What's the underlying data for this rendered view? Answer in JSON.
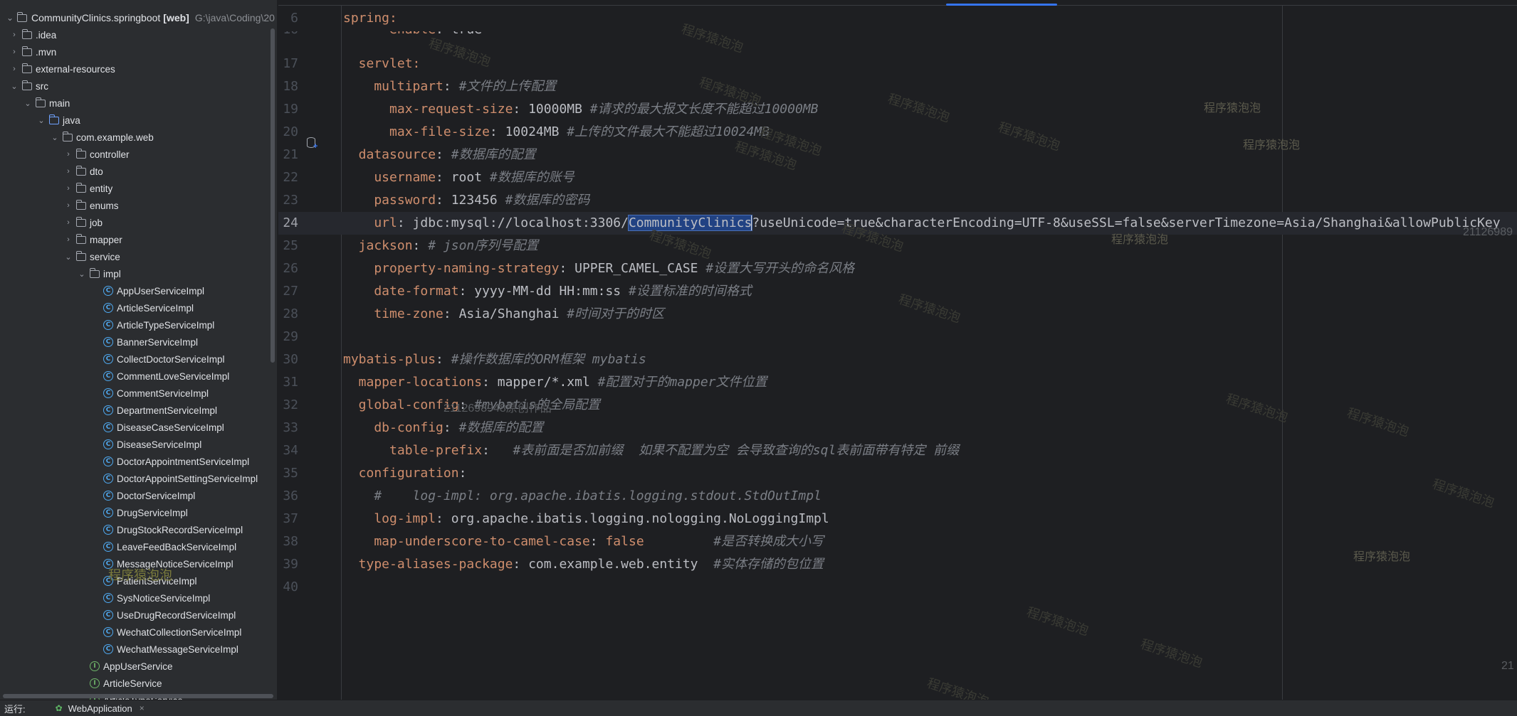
{
  "project_tree": {
    "root": {
      "name": "CommunityClinics.springboot",
      "flag": "[web]",
      "path": "G:\\java\\Coding\\20"
    },
    "items": [
      {
        "label": ".idea",
        "type": "folder",
        "depth": 1,
        "arrow": "›"
      },
      {
        "label": ".mvn",
        "type": "folder",
        "depth": 1,
        "arrow": "›"
      },
      {
        "label": "external-resources",
        "type": "folder",
        "depth": 1,
        "arrow": "›"
      },
      {
        "label": "src",
        "type": "folder",
        "depth": 1,
        "arrow": "⌄"
      },
      {
        "label": "main",
        "type": "folder",
        "depth": 2,
        "arrow": "⌄"
      },
      {
        "label": "java",
        "type": "src-folder",
        "depth": 3,
        "arrow": "⌄"
      },
      {
        "label": "com.example.web",
        "type": "folder",
        "depth": 4,
        "arrow": "⌄"
      },
      {
        "label": "controller",
        "type": "folder",
        "depth": 5,
        "arrow": "›"
      },
      {
        "label": "dto",
        "type": "folder",
        "depth": 5,
        "arrow": "›"
      },
      {
        "label": "entity",
        "type": "folder",
        "depth": 5,
        "arrow": "›"
      },
      {
        "label": "enums",
        "type": "folder",
        "depth": 5,
        "arrow": "›"
      },
      {
        "label": "job",
        "type": "folder",
        "depth": 5,
        "arrow": "›"
      },
      {
        "label": "mapper",
        "type": "folder",
        "depth": 5,
        "arrow": "›"
      },
      {
        "label": "service",
        "type": "folder",
        "depth": 5,
        "arrow": "⌄"
      },
      {
        "label": "impl",
        "type": "folder",
        "depth": 6,
        "arrow": "⌄"
      },
      {
        "label": "AppUserServiceImpl",
        "type": "class",
        "depth": 7,
        "arrow": ""
      },
      {
        "label": "ArticleServiceImpl",
        "type": "class",
        "depth": 7,
        "arrow": ""
      },
      {
        "label": "ArticleTypeServiceImpl",
        "type": "class",
        "depth": 7,
        "arrow": ""
      },
      {
        "label": "BannerServiceImpl",
        "type": "class",
        "depth": 7,
        "arrow": ""
      },
      {
        "label": "CollectDoctorServiceImpl",
        "type": "class",
        "depth": 7,
        "arrow": ""
      },
      {
        "label": "CommentLoveServiceImpl",
        "type": "class",
        "depth": 7,
        "arrow": ""
      },
      {
        "label": "CommentServiceImpl",
        "type": "class",
        "depth": 7,
        "arrow": ""
      },
      {
        "label": "DepartmentServiceImpl",
        "type": "class",
        "depth": 7,
        "arrow": ""
      },
      {
        "label": "DiseaseCaseServiceImpl",
        "type": "class",
        "depth": 7,
        "arrow": ""
      },
      {
        "label": "DiseaseServiceImpl",
        "type": "class",
        "depth": 7,
        "arrow": ""
      },
      {
        "label": "DoctorAppointmentServiceImpl",
        "type": "class",
        "depth": 7,
        "arrow": ""
      },
      {
        "label": "DoctorAppointSettingServiceImpl",
        "type": "class",
        "depth": 7,
        "arrow": ""
      },
      {
        "label": "DoctorServiceImpl",
        "type": "class",
        "depth": 7,
        "arrow": ""
      },
      {
        "label": "DrugServiceImpl",
        "type": "class",
        "depth": 7,
        "arrow": ""
      },
      {
        "label": "DrugStockRecordServiceImpl",
        "type": "class",
        "depth": 7,
        "arrow": ""
      },
      {
        "label": "LeaveFeedBackServiceImpl",
        "type": "class",
        "depth": 7,
        "arrow": ""
      },
      {
        "label": "MessageNoticeServiceImpl",
        "type": "class",
        "depth": 7,
        "arrow": ""
      },
      {
        "label": "PatientServiceImpl",
        "type": "class",
        "depth": 7,
        "arrow": ""
      },
      {
        "label": "SysNoticeServiceImpl",
        "type": "class",
        "depth": 7,
        "arrow": ""
      },
      {
        "label": "UseDrugRecordServiceImpl",
        "type": "class",
        "depth": 7,
        "arrow": ""
      },
      {
        "label": "WechatCollectionServiceImpl",
        "type": "class",
        "depth": 7,
        "arrow": ""
      },
      {
        "label": "WechatMessageServiceImpl",
        "type": "class",
        "depth": 7,
        "arrow": ""
      },
      {
        "label": "AppUserService",
        "type": "interface",
        "depth": 6,
        "arrow": ""
      },
      {
        "label": "ArticleService",
        "type": "interface",
        "depth": 6,
        "arrow": ""
      },
      {
        "label": "ArticleTypeService",
        "type": "interface",
        "depth": 6,
        "arrow": ""
      }
    ]
  },
  "editor": {
    "current_line": "24",
    "lines": [
      {
        "n": "6",
        "segs": [
          [
            "k",
            "spring:"
          ]
        ]
      },
      {
        "n": "16",
        "segs": [
          [
            "k",
            "      enable"
          ],
          [
            "v",
            ": true"
          ]
        ]
      },
      {
        "n": "17",
        "segs": [
          [
            "k",
            "  servlet:"
          ]
        ]
      },
      {
        "n": "18",
        "segs": [
          [
            "k",
            "    multipart"
          ],
          [
            "v",
            ": "
          ],
          [
            "c",
            "#文件的上传配置"
          ]
        ]
      },
      {
        "n": "19",
        "segs": [
          [
            "k",
            "      max-request-size"
          ],
          [
            "v",
            ": 10000MB "
          ],
          [
            "c",
            "#请求的最大报文长度不能超过10000MB"
          ]
        ]
      },
      {
        "n": "20",
        "segs": [
          [
            "k",
            "      max-file-size"
          ],
          [
            "v",
            ": 10024MB "
          ],
          [
            "c",
            "#上传的文件最大不能超过10024MB"
          ]
        ]
      },
      {
        "n": "21",
        "segs": [
          [
            "k",
            "  datasource"
          ],
          [
            "v",
            ": "
          ],
          [
            "c",
            "#数据库的配置"
          ]
        ]
      },
      {
        "n": "22",
        "segs": [
          [
            "k",
            "    username"
          ],
          [
            "v",
            ": root "
          ],
          [
            "c",
            "#数据库的账号"
          ]
        ]
      },
      {
        "n": "23",
        "segs": [
          [
            "k",
            "    password"
          ],
          [
            "v",
            ": 123456 "
          ],
          [
            "c",
            "#数据库的密码"
          ]
        ]
      },
      {
        "n": "24",
        "segs": [
          [
            "k",
            "    url"
          ],
          [
            "v",
            ": jdbc:mysql://localhost:3306/"
          ],
          [
            "sel",
            "CommunityClinics"
          ],
          [
            "caret",
            ""
          ],
          [
            "v",
            "?useUnicode=true&characterEncoding=UTF-8&useSSL=false&serverTimezone=Asia/Shanghai&allowPublicKey"
          ]
        ]
      },
      {
        "n": "25",
        "segs": [
          [
            "k",
            "  jackson"
          ],
          [
            "v",
            ": "
          ],
          [
            "c",
            "# json序列号配置"
          ]
        ]
      },
      {
        "n": "26",
        "segs": [
          [
            "k",
            "    property-naming-strategy"
          ],
          [
            "v",
            ": UPPER_CAMEL_CASE "
          ],
          [
            "c",
            "#设置大写开头的命名风格"
          ]
        ]
      },
      {
        "n": "27",
        "segs": [
          [
            "k",
            "    date-format"
          ],
          [
            "v",
            ": yyyy-MM-dd HH:mm:ss "
          ],
          [
            "c",
            "#设置标准的时间格式"
          ]
        ]
      },
      {
        "n": "28",
        "segs": [
          [
            "k",
            "    time-zone"
          ],
          [
            "v",
            ": Asia/Shanghai "
          ],
          [
            "c",
            "#时间对于的时区"
          ]
        ]
      },
      {
        "n": "29",
        "segs": []
      },
      {
        "n": "30",
        "segs": [
          [
            "k",
            "mybatis-plus"
          ],
          [
            "v",
            ": "
          ],
          [
            "c",
            "#操作数据库的ORM框架 mybatis"
          ]
        ]
      },
      {
        "n": "31",
        "segs": [
          [
            "k",
            "  mapper-locations"
          ],
          [
            "v",
            ": mapper/*.xml "
          ],
          [
            "c",
            "#配置对于的mapper文件位置"
          ]
        ]
      },
      {
        "n": "32",
        "segs": [
          [
            "k",
            "  global-config"
          ],
          [
            "v",
            ": "
          ],
          [
            "c",
            "#mybatis的全局配置"
          ]
        ]
      },
      {
        "n": "33",
        "segs": [
          [
            "k",
            "    db-config"
          ],
          [
            "v",
            ": "
          ],
          [
            "c",
            "#数据库的配置"
          ]
        ]
      },
      {
        "n": "34",
        "segs": [
          [
            "k",
            "      table-prefix"
          ],
          [
            "v",
            ":   "
          ],
          [
            "c",
            "#表前面是否加前缀  如果不配置为空 会导致查询的sql表前面带有特定 前缀"
          ]
        ]
      },
      {
        "n": "35",
        "segs": [
          [
            "k",
            "  configuration"
          ],
          [
            "v",
            ":"
          ]
        ]
      },
      {
        "n": "36",
        "segs": [
          [
            "c",
            "    #    log-impl: org.apache.ibatis.logging.stdout.StdOutImpl"
          ]
        ]
      },
      {
        "n": "37",
        "segs": [
          [
            "k",
            "    log-impl"
          ],
          [
            "v",
            ": org.apache.ibatis.logging.nologging.NoLoggingImpl"
          ]
        ]
      },
      {
        "n": "38",
        "segs": [
          [
            "k",
            "    map-underscore-to-camel-case"
          ],
          [
            "v",
            ": "
          ],
          [
            "k",
            "false"
          ],
          [
            "v",
            "         "
          ],
          [
            "c",
            "#是否转换成大小写"
          ]
        ]
      },
      {
        "n": "39",
        "segs": [
          [
            "k",
            "  type-aliases-package"
          ],
          [
            "v",
            ": com.example.web.entity  "
          ],
          [
            "c",
            "#实体存储的包位置"
          ]
        ]
      },
      {
        "n": "40",
        "segs": []
      }
    ]
  },
  "watermarks": {
    "text": "程序猿泡泡",
    "author": "2112698948原创作品",
    "id_right": "21126989",
    "id_bottom": "21"
  },
  "bottom_bar": {
    "run_label": "运行:",
    "tab_label": "WebApplication"
  },
  "colors": {
    "keyword": "#cf8e6d",
    "value": "#bcbec4",
    "comment": "#7a7e85",
    "selection": "#214283",
    "accent": "#3574f0"
  }
}
